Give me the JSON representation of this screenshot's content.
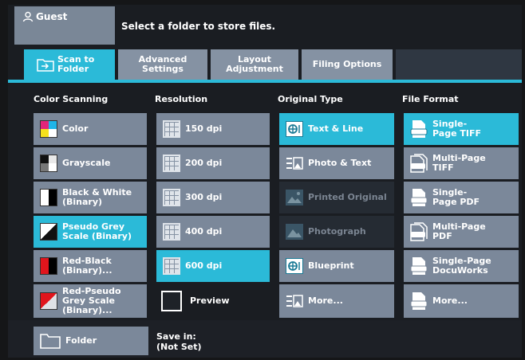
{
  "header": {
    "user": "Guest",
    "message": "Select a folder to store files."
  },
  "tabs": [
    {
      "label": "Scan to Folder"
    },
    {
      "label": "Advanced Settings"
    },
    {
      "label": "Layout Adjustment"
    },
    {
      "label": "Filing Options"
    }
  ],
  "columns": {
    "color_scanning": {
      "heading": "Color Scanning",
      "items": [
        "Color",
        "Grayscale",
        "Black & White (Binary)",
        "Pseudo Grey Scale (Binary)",
        "Red-Black (Binary)...",
        "Red-Pseudo Grey Scale (Binary)..."
      ]
    },
    "resolution": {
      "heading": "Resolution",
      "items": [
        "150 dpi",
        "200 dpi",
        "300 dpi",
        "400 dpi",
        "600 dpi"
      ],
      "preview": "Preview"
    },
    "original_type": {
      "heading": "Original Type",
      "items": [
        "Text & Line",
        "Photo & Text",
        "Printed Original",
        "Photograph",
        "Blueprint",
        "More..."
      ]
    },
    "file_format": {
      "heading": "File Format",
      "items": [
        "Single-Page TIFF",
        "Multi-Page TIFF",
        "Single-Page PDF",
        "Multi-Page PDF",
        "Single-Page DocuWorks",
        "More..."
      ]
    }
  },
  "footer": {
    "folder_label": "Folder",
    "save_in_label": "Save in:",
    "save_in_value": "(Not Set)"
  },
  "colors": {
    "accent": "#2bbad8",
    "button": "#7b889a",
    "background": "#1a1d22"
  }
}
